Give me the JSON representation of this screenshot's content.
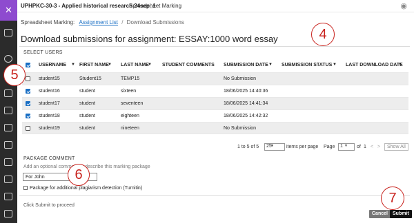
{
  "topbar": {
    "course": "UPHPKC-30-3 - Applied historical research 24sep_1",
    "tab": "Spreadsheet Marking",
    "eye_icon": "eye-icon"
  },
  "breadcrumb": {
    "root": "Spreadsheet Marking:",
    "link": "Assignment List",
    "separator": "/",
    "current": "Download Submissions"
  },
  "title": "Download submissions for assignment: ESSAY:1000 word essay",
  "select_users_label": "SELECT USERS",
  "table": {
    "headers": [
      "USERNAME",
      "FIRST NAME",
      "LAST NAME",
      "STUDENT COMMENTS",
      "SUBMISSION DATE",
      "SUBMISSION STATUS",
      "LAST DOWNLOAD DATE"
    ],
    "rows": [
      {
        "checked": false,
        "username": "student15",
        "first": "Student15",
        "last": "TEMP15",
        "comments": "",
        "date": "No Submission",
        "status": "",
        "last_dl": ""
      },
      {
        "checked": true,
        "username": "student16",
        "first": "student",
        "last": "sixteen",
        "comments": "",
        "date": "18/06/2025 14:40:36",
        "status": "",
        "last_dl": ""
      },
      {
        "checked": true,
        "username": "student17",
        "first": "student",
        "last": "seventeen",
        "comments": "",
        "date": "18/06/2025 14:41:34",
        "status": "",
        "last_dl": ""
      },
      {
        "checked": true,
        "username": "student18",
        "first": "student",
        "last": "eighteen",
        "comments": "",
        "date": "18/06/2025 14:42:32",
        "status": "",
        "last_dl": ""
      },
      {
        "checked": false,
        "username": "student19",
        "first": "student",
        "last": "nineteen",
        "comments": "",
        "date": "No Submission",
        "status": "",
        "last_dl": ""
      }
    ]
  },
  "pager": {
    "range": "1 to 5 of 5",
    "per_page": "25",
    "items_label": "items per page",
    "page_label": "Page",
    "page": "1",
    "of": "of",
    "total": "1",
    "prev": "<",
    "next": ">",
    "show_all": "Show All"
  },
  "package": {
    "title": "PACKAGE COMMENT",
    "help": "Add an optional comment to describe this marking package",
    "value": "For John",
    "turnitin": "Package for additional plagiarism detection (Turnitin)"
  },
  "footer": {
    "hint": "Click Submit to proceed",
    "cancel": "Cancel",
    "submit": "Submit"
  },
  "callouts": [
    "4",
    "5",
    "6",
    "7"
  ],
  "colors": {
    "accent": "#1a6fc4",
    "callout": "#c8211c",
    "rail": "#2b2b2b",
    "brand": "#8e4bcf"
  }
}
